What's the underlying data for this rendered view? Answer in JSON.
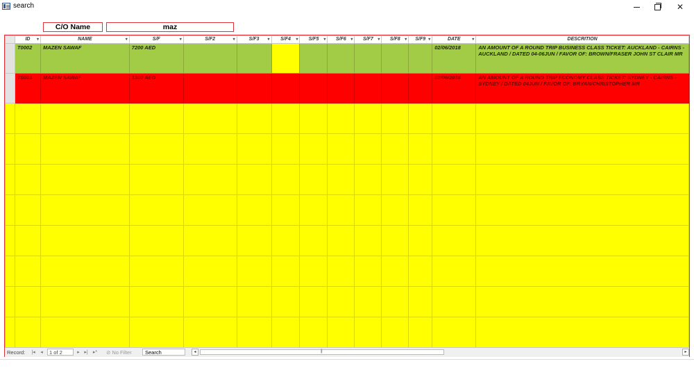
{
  "window": {
    "title": "search",
    "minimize_glyph": "–",
    "close_glyph": "✕",
    "icon": "form-icon"
  },
  "form": {
    "co_label": "C/O Name",
    "co_value": "maz"
  },
  "grid": {
    "columns": [
      {
        "key": "id",
        "label": "ID",
        "dropdown": "▾"
      },
      {
        "key": "name",
        "label": "NAME",
        "dropdown": "▾"
      },
      {
        "key": "sf",
        "label": "S/F",
        "dropdown": "▾"
      },
      {
        "key": "sf2",
        "label": "S/F2",
        "dropdown": "▾"
      },
      {
        "key": "sf3",
        "label": "S/F3",
        "dropdown": "▾"
      },
      {
        "key": "sf4",
        "label": "S/F4",
        "dropdown": "▾"
      },
      {
        "key": "sf5",
        "label": "S/F5",
        "dropdown": "▾"
      },
      {
        "key": "sf6",
        "label": "S/F6",
        "dropdown": "▾"
      },
      {
        "key": "sf7",
        "label": "S/F7",
        "dropdown": "▾"
      },
      {
        "key": "sf8",
        "label": "S/F8",
        "dropdown": "▾"
      },
      {
        "key": "sf9",
        "label": "S/F9",
        "dropdown": "▾"
      },
      {
        "key": "date",
        "label": "DATE",
        "dropdown": "▾"
      },
      {
        "key": "desc",
        "label": "DESCRITION",
        "dropdown": ""
      }
    ],
    "rows": [
      {
        "color": "#a3cc46",
        "cells": [
          "T0002",
          "MAZEN SAWAF",
          "7200 AED",
          "",
          "",
          "",
          "",
          "",
          "",
          "",
          "",
          "02/06/2018",
          "AN AMOUNT OF A ROUND TRIP BUSINESS CLASS TICKET: AUCKLAND - CAIRNS - AUCKLAND / DATED 04-06JUN / FAVOR OF: BROWN/FRASER JOHN ST CLAIR MR"
        ]
      },
      {
        "color": "#ff0000",
        "cells": [
          "T0003",
          "MAZEN SAWAF",
          "1300 AED",
          "",
          "",
          "",
          "",
          "",
          "",
          "",
          "",
          "02/06/2018",
          "AN AMOUNT OF A ROUND TRIP ECONOMY CLASS TICKET: SYDNEY - CAIRNS - SYDNEY / DATED 04JUN / FAVOR OF: BRYAN/CHRISTOPHER MR"
        ]
      }
    ],
    "blank_row_color": "#ffff00"
  },
  "statusbar": {
    "record_label": "Record:",
    "first": "|◂",
    "prev": "◂",
    "record_value": "1 of 2",
    "next": "▸",
    "last": "▸|",
    "new": "▸*",
    "no_filter": "No Filter",
    "search_value": "Search",
    "scroll_left": "◂",
    "scroll_right": "▸",
    "scroll_grip": "|||"
  }
}
